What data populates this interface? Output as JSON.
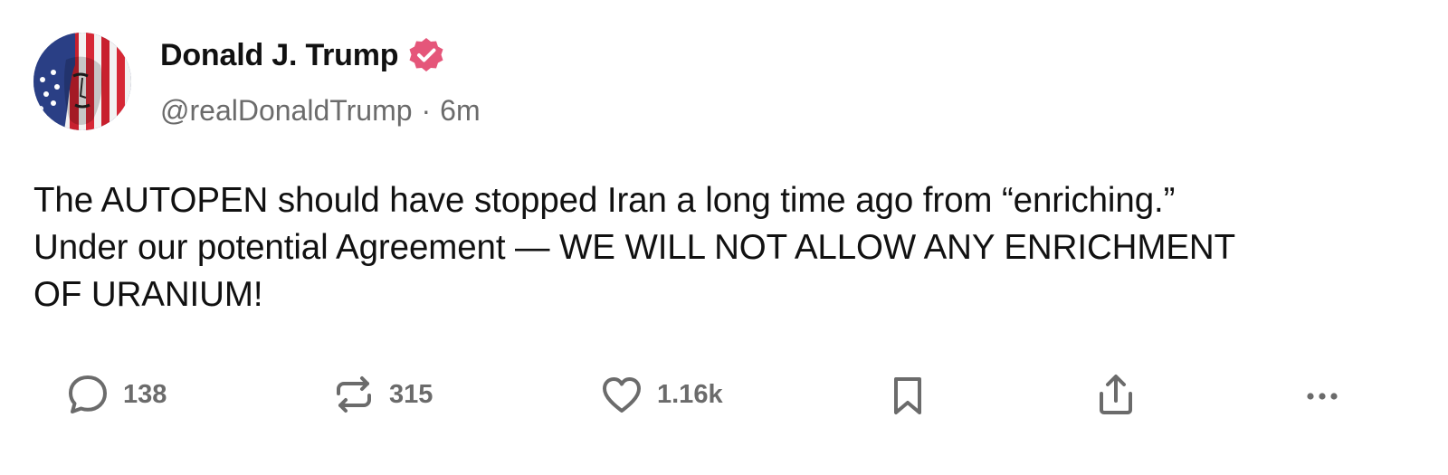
{
  "author": {
    "display_name": "Donald J. Trump",
    "handle": "@realDonaldTrump",
    "separator": "·",
    "time_ago": "6m",
    "verified": true,
    "verified_color": "#e5567a",
    "avatar_icon": "profile-photo-flag-face"
  },
  "post": {
    "text": "The AUTOPEN should have stopped Iran a long time ago from “enriching.”\nUnder our potential Agreement — WE WILL NOT ALLOW ANY ENRICHMENT\nOF URANIUM!"
  },
  "actions": {
    "replies": "138",
    "reposts": "315",
    "likes": "1.16k",
    "icons": [
      "reply-icon",
      "repost-icon",
      "like-icon",
      "bookmark-icon",
      "share-icon",
      "more-icon"
    ],
    "icon_color": "#6b6b6b"
  }
}
